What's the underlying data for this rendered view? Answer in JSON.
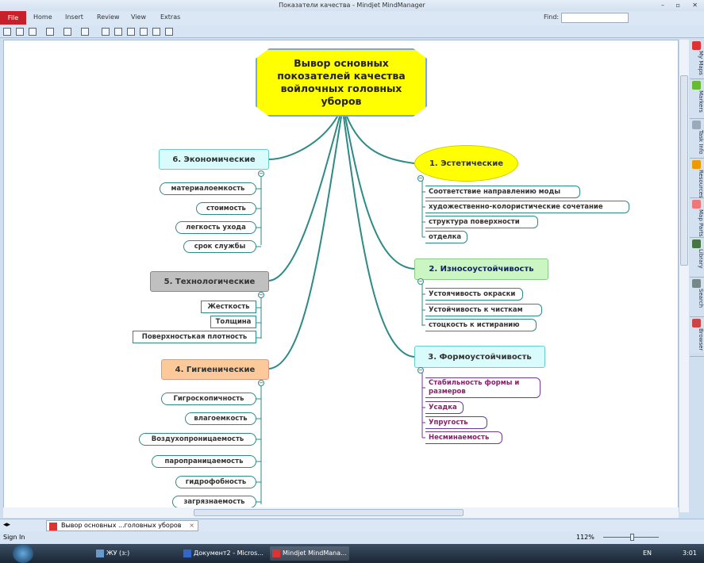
{
  "window": {
    "title": "Показатели качества - Mindjet MindManager"
  },
  "ribbon": {
    "file": "File",
    "tabs": [
      "Home",
      "Insert",
      "Review",
      "View",
      "Extras"
    ],
    "find_label": "Find:",
    "find_value": ""
  },
  "central": {
    "title": "Вывор основных покозателей качества войлочных головных уборов"
  },
  "branches": {
    "b6": {
      "label": "6. Экономические",
      "children": [
        "материалоемкость",
        "стоимость",
        "легкость ухода",
        "срок службы"
      ]
    },
    "b5": {
      "label": "5. Технологические",
      "children": [
        "Жесткость",
        "Толщина",
        "Поверхностькая плотность"
      ]
    },
    "b4": {
      "label": "4. Гигиенические",
      "children": [
        "Гигроскопичность",
        "влагоемкость",
        "Воздухопроницаемость",
        "паропраницаемость",
        "гидрофобность",
        "загрязнаемость"
      ]
    },
    "b1": {
      "label": "1. Эстетические",
      "children": [
        "Соответствие направлению моды",
        "художественно-колористические сочетание",
        "структура поверхности",
        "отделка"
      ]
    },
    "b2": {
      "label": "2. Износоустойчивость",
      "children": [
        "Устоячивость окраски",
        "Устойчивость к чисткам",
        "стоцкость к истиранию"
      ]
    },
    "b3": {
      "label": "3. Формоустойчивость",
      "children": [
        "Стабильность формы и размеров",
        "Усадка",
        "Упругость",
        "Несминаемость"
      ]
    }
  },
  "side_panel": [
    "My Maps",
    "Markers",
    "Task Info",
    "Resources",
    "Map Parts",
    "Library",
    "Search",
    "Browser"
  ],
  "doc_tab": "Вывор основных ...головных уборов",
  "status": {
    "sign_in": "Sign In",
    "zoom": "112%"
  },
  "taskbar": {
    "items": [
      "ЖУ (з:)",
      "Документ2 - Micros...",
      "Mindjet MindMana..."
    ],
    "lang": "EN",
    "time": "3:01"
  },
  "colors": {
    "file": "#c8202a",
    "connector": "#2d8a86",
    "central": "#ffff00"
  }
}
